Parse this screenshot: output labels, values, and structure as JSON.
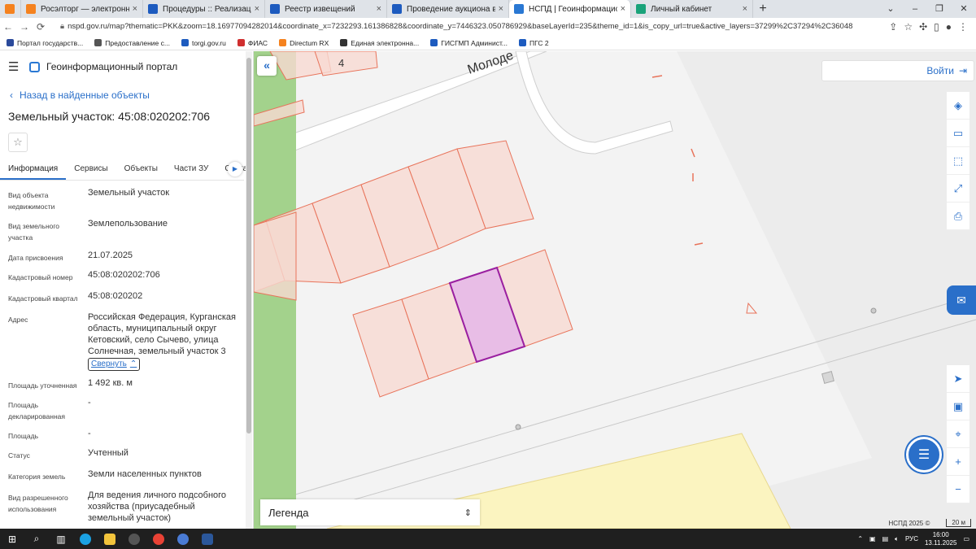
{
  "browser": {
    "tabs": [
      {
        "label": "",
        "color": "#f5821f",
        "active": false
      },
      {
        "label": "Росэлторг — электронная торг",
        "color": "#f5821f",
        "active": false
      },
      {
        "label": "Процедуры :: Реализация госи",
        "color": "#1d5bbf",
        "active": false
      },
      {
        "label": "Реестр извещений",
        "color": "#1d5bbf",
        "active": false
      },
      {
        "label": "Проведение аукциона в электр",
        "color": "#1d5bbf",
        "active": false
      },
      {
        "label": "НСПД | Геоинформационный п",
        "color": "#2a78d3",
        "active": true
      },
      {
        "label": "Личный кабинет",
        "color": "#1aa37a",
        "active": false
      }
    ],
    "new_tab": "+",
    "url": "nspd.gov.ru/map?thematic=PKK&zoom=18.16977094282014&coordinate_x=7232293.161386828&coordinate_y=7446323.050786929&baseLayerId=235&theme_id=1&is_copy_url=true&active_layers=37299%2C37294%2C36048",
    "bookmarks": [
      {
        "label": "Портал государств...",
        "color": "#2b4a9b"
      },
      {
        "label": "Предоставление с...",
        "color": "#555555"
      },
      {
        "label": "torgi.gov.ru",
        "color": "#1d5bbf"
      },
      {
        "label": "ФИАС",
        "color": "#d02f2f"
      },
      {
        "label": "Directum RX",
        "color": "#f5821f"
      },
      {
        "label": "Единая электронна...",
        "color": "#333333"
      },
      {
        "label": "ГИСГМП Админист...",
        "color": "#1d5bbf"
      },
      {
        "label": "ПГС 2",
        "color": "#1d5bbf"
      }
    ]
  },
  "sidebar": {
    "app_title": "Геоинформационный портал",
    "back_label": "Назад в найденные объекты",
    "object_title": "Земельный участок: 45:08:020202:706",
    "tabs": [
      "Информация",
      "Сервисы",
      "Объекты",
      "Части ЗУ",
      "Соста"
    ],
    "properties": [
      {
        "label": "Вид объекта недвижимости",
        "value": "Земельный участок"
      },
      {
        "label": "Вид земельного участка",
        "value": "Землепользование"
      },
      {
        "label": "Дата присвоения",
        "value": "21.07.2025"
      },
      {
        "label": "Кадастровый номер",
        "value": "45:08:020202:706"
      },
      {
        "label": "Кадастровый квартал",
        "value": "45:08:020202"
      },
      {
        "label": "Адрес",
        "value": "Российская Федерация, Курганская область, муниципальный округ Кетовский, село Сычево, улица Солнечная, земельный участок 3"
      },
      {
        "label": "Площадь уточненная",
        "value": "1 492 кв. м"
      },
      {
        "label": "Площадь декларированная",
        "value": "-"
      },
      {
        "label": "Площадь",
        "value": "-"
      },
      {
        "label": "Статус",
        "value": "Учтенный"
      },
      {
        "label": "Категория земель",
        "value": "Земли населенных пунктов"
      },
      {
        "label": "Вид разрешенного использования",
        "value": "Для ведения личного подсобного хозяйства (приусадебный земельный участок)"
      }
    ],
    "collapse_label": "Свернуть"
  },
  "map": {
    "street_label": "Молоде",
    "house_number": "4",
    "login_label": "Войти",
    "legend_label": "Легенда",
    "attribution": "НСПД 2025 ©",
    "scale_label": "20 м",
    "colors": {
      "parcel_stroke": "#e8735a",
      "parcel_fill": "#f7d9d2",
      "selected_stroke": "#9a1fa0",
      "selected_fill": "#e8bde6",
      "green_strip": "#a3d28c",
      "yellow_zone": "#fbf4c0",
      "accent": "#2a6fc9"
    }
  },
  "taskbar": {
    "lang": "РУС",
    "time": "16:00",
    "date": "13.11.2025"
  }
}
